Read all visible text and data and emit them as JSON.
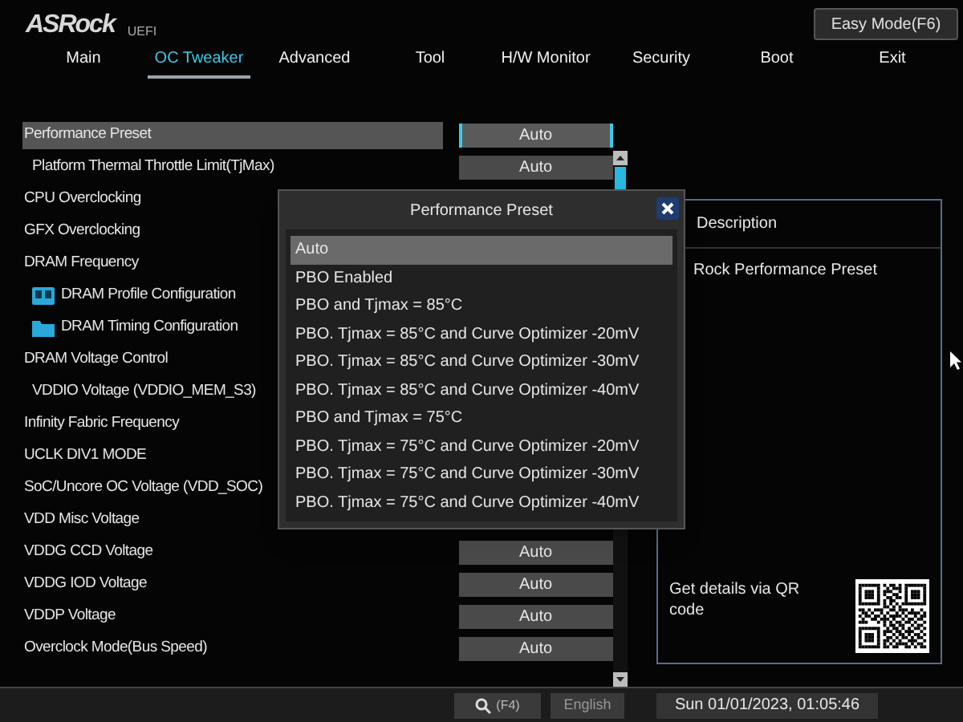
{
  "header": {
    "logo": "ASRock",
    "logo_suffix": "UEFI",
    "mode_button": "Easy Mode(F6)"
  },
  "tabs": [
    {
      "label": "Main",
      "selected": false
    },
    {
      "label": "OC Tweaker",
      "selected": true
    },
    {
      "label": "Advanced",
      "selected": false
    },
    {
      "label": "Tool",
      "selected": false
    },
    {
      "label": "H/W Monitor",
      "selected": false
    },
    {
      "label": "Security",
      "selected": false
    },
    {
      "label": "Boot",
      "selected": false
    },
    {
      "label": "Exit",
      "selected": false
    }
  ],
  "settings": [
    {
      "label": "Performance Preset",
      "kind": "setting",
      "value": "Auto",
      "selected": true
    },
    {
      "label": "Platform Thermal Throttle Limit(TjMax)",
      "kind": "subsetting",
      "value": "Auto",
      "selected": false
    },
    {
      "label": "CPU Overclocking",
      "kind": "setting",
      "selected": false
    },
    {
      "label": "GFX Overclocking",
      "kind": "setting",
      "selected": false
    },
    {
      "label": "DRAM Frequency",
      "kind": "setting",
      "selected": false
    },
    {
      "label": "DRAM Profile Configuration",
      "kind": "profile",
      "selected": false
    },
    {
      "label": "DRAM Timing Configuration",
      "kind": "folder",
      "selected": false
    },
    {
      "label": "DRAM Voltage Control",
      "kind": "setting",
      "selected": false
    },
    {
      "label": "VDDIO Voltage (VDDIO_MEM_S3)",
      "kind": "subsetting",
      "selected": false
    },
    {
      "label": "Infinity Fabric Frequency",
      "kind": "setting",
      "selected": false
    },
    {
      "label": "UCLK DIV1 MODE",
      "kind": "setting",
      "selected": false
    },
    {
      "label": "SoC/Uncore OC Voltage (VDD_SOC)",
      "kind": "setting",
      "selected": false
    },
    {
      "label": "VDD Misc Voltage",
      "kind": "setting",
      "selected": false
    },
    {
      "label": "VDDG CCD Voltage",
      "kind": "setting",
      "value": "Auto",
      "selected": false
    },
    {
      "label": "VDDG IOD Voltage",
      "kind": "setting",
      "value": "Auto",
      "selected": false
    },
    {
      "label": "VDDP Voltage",
      "kind": "setting",
      "value": "Auto",
      "selected": false
    },
    {
      "label": "Overclock Mode(Bus Speed)",
      "kind": "setting",
      "value": "Auto",
      "selected": false
    }
  ],
  "description": {
    "title": "Description",
    "text": "Rock Performance Preset",
    "qr_text": "Get details via QR code"
  },
  "dialog": {
    "title": "Performance Preset",
    "options": [
      {
        "label": "Auto",
        "selected": true
      },
      {
        "label": "PBO Enabled",
        "selected": false
      },
      {
        "label": "PBO and Tjmax = 85°C",
        "selected": false
      },
      {
        "label": "PBO. Tjmax = 85°C and Curve Optimizer -20mV",
        "selected": false
      },
      {
        "label": "PBO. Tjmax = 85°C and Curve Optimizer -30mV",
        "selected": false
      },
      {
        "label": "PBO. Tjmax = 85°C and Curve Optimizer -40mV",
        "selected": false
      },
      {
        "label": "PBO and Tjmax = 75°C",
        "selected": false
      },
      {
        "label": "PBO. Tjmax = 75°C and Curve Optimizer -20mV",
        "selected": false
      },
      {
        "label": "PBO. Tjmax = 75°C and Curve Optimizer -30mV",
        "selected": false
      },
      {
        "label": "PBO. Tjmax = 75°C and Curve Optimizer -40mV",
        "selected": false
      }
    ]
  },
  "status_bar": {
    "search_key": "(F4)",
    "language": "English",
    "datetime": "Sun 01/01/2023, 01:05:46"
  }
}
